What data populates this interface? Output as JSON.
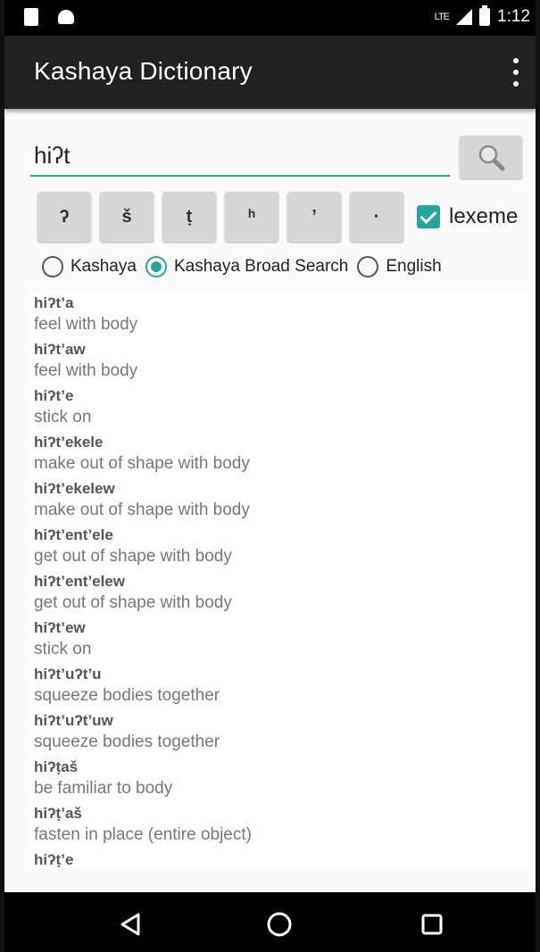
{
  "app": {
    "title": "Kashaya Dictionary",
    "accent_color": "#26a69a",
    "appbar_color": "#212121"
  },
  "status_bar": {
    "time": "1:12",
    "network": "LTE"
  },
  "search": {
    "value": "hiʔt",
    "button_icon": "magnifier-icon"
  },
  "char_buttons": [
    "ʔ",
    "š",
    "ṭ",
    "ʰ",
    "ʼ",
    "·"
  ],
  "lexeme": {
    "label": "lexeme",
    "checked": true
  },
  "search_modes": [
    {
      "label": "Kashaya",
      "selected": false
    },
    {
      "label": "Kashaya Broad Search",
      "selected": true
    },
    {
      "label": "English",
      "selected": false
    }
  ],
  "results": [
    {
      "term": "hiʔt’a",
      "definition": "feel with body"
    },
    {
      "term": "hiʔt’aw",
      "definition": "feel with body"
    },
    {
      "term": "hiʔt’e",
      "definition": "stick on"
    },
    {
      "term": "hiʔt’ekele",
      "definition": "make out of shape with body"
    },
    {
      "term": "hiʔt’ekelew",
      "definition": "make out of shape with body"
    },
    {
      "term": "hiʔt’ent’ele",
      "definition": "get out of shape with body"
    },
    {
      "term": "hiʔt’ent’elew",
      "definition": "get out of shape with body"
    },
    {
      "term": "hiʔt’ew",
      "definition": "stick on"
    },
    {
      "term": "hiʔt’uʔt’u",
      "definition": "squeeze bodies together"
    },
    {
      "term": "hiʔt’uʔt’uw",
      "definition": "squeeze bodies together"
    },
    {
      "term": "hiʔṭaš",
      "definition": "be familiar to body"
    },
    {
      "term": "hiʔṭ’aš",
      "definition": "fasten in place (entire object)"
    },
    {
      "term": "hiʔṭ’e",
      "definition": ""
    }
  ],
  "nav_bar": {
    "back_icon": "back-triangle-icon",
    "home_icon": "home-circle-icon",
    "recents_icon": "recents-square-icon"
  }
}
